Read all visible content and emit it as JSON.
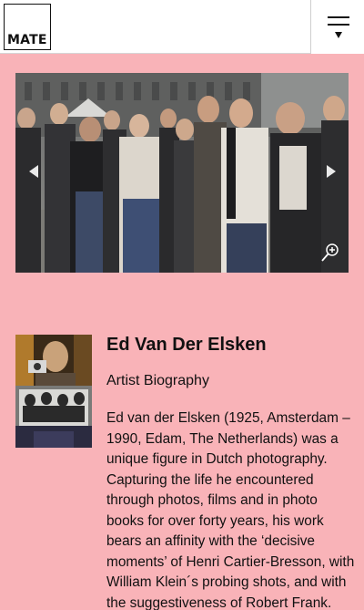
{
  "header": {
    "logo_text": "MATE",
    "menu_icon": "hamburger-menu-icon"
  },
  "hero": {
    "image_description_icon": "group-photo",
    "prev_icon": "chevron-left-icon",
    "next_icon": "chevron-right-icon",
    "zoom_icon": "zoom-in-icon"
  },
  "artist": {
    "name": "Ed Van Der Elsken",
    "section": "Artist Biography",
    "bio_lines": [
      "Ed van der Elsken (1925, Amsterdam –",
      "1990, Edam, The Netherlands) was a",
      "unique figure in Dutch photography.",
      "Capturing the life he encountered",
      "through photos, films and in photo",
      "books for over forty years, his work",
      "bears an affinity with the ‘decisive",
      "moments’ of Henri Cartier-Bresson, with",
      "William Klein´s probing shots, and with",
      "the suggestiveness of Robert Frank."
    ]
  },
  "colors": {
    "page_background": "#f9b3b8",
    "header_background": "#ffffff",
    "text": "#111111"
  }
}
